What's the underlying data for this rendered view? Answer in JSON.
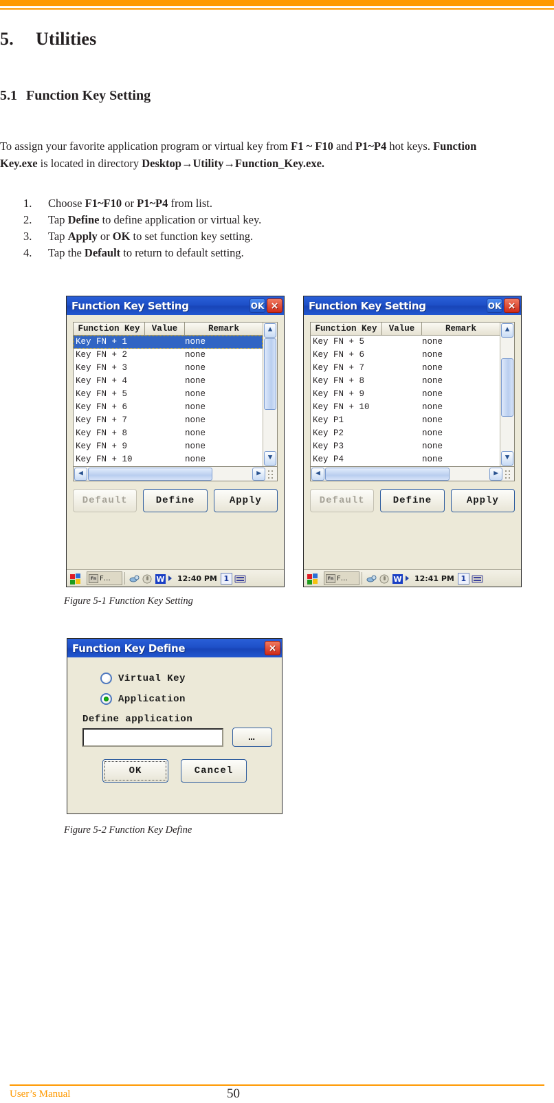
{
  "document": {
    "chapter_number": "5.",
    "chapter_title": "Utilities",
    "section_number": "5.1",
    "section_title": "Function Key Setting",
    "intro": {
      "p1": "To assign your favorite application program or virtual key from ",
      "b1": "F1 ~ F10",
      "p2": " and  ",
      "b2": "P1~P4",
      "p3": " hot keys. ",
      "b3": "Function Key.exe",
      "p4": " is located in directory ",
      "b4": "Desktop→Utility→Function_Key.exe."
    },
    "steps": [
      {
        "marker": "1.",
        "pre": "Choose ",
        "b1": "F1~F10",
        "mid": " or ",
        "b2": "P1~P4",
        "post": " from list."
      },
      {
        "marker": "2.",
        "pre": "Tap ",
        "b1": "Define",
        "mid": "",
        "b2": "",
        "post": " to define application or virtual key."
      },
      {
        "marker": "3.",
        "pre": "Tap ",
        "b1": "Apply",
        "mid": " or ",
        "b2": "OK",
        "post": " to set function key setting."
      },
      {
        "marker": "4.",
        "pre": "Tap the ",
        "b1": "Default",
        "mid": "",
        "b2": "",
        "post": " to return to default setting."
      }
    ],
    "captions": {
      "fig_5_1": "Figure 5-1 Function Key Setting",
      "fig_5_2": "Figure 5-2 Function Key Define"
    },
    "footer": {
      "left": "User’s Manual",
      "page": "50"
    },
    "colors": {
      "accent": "#ff9900",
      "titlebar": "#1e50c8",
      "selection": "#3165c4",
      "radio_on": "#12b312"
    }
  },
  "fig1_left": {
    "title": "Function Key Setting",
    "ok_label": "OK",
    "close_label": "×",
    "columns": [
      "Function Key",
      "Value",
      "Remark"
    ],
    "rows": [
      {
        "key": "Key FN + 1",
        "value": "",
        "remark": "none",
        "selected": true
      },
      {
        "key": "Key FN + 2",
        "value": "",
        "remark": "none",
        "selected": false
      },
      {
        "key": "Key FN + 3",
        "value": "",
        "remark": "none",
        "selected": false
      },
      {
        "key": "Key FN + 4",
        "value": "",
        "remark": "none",
        "selected": false
      },
      {
        "key": "Key FN + 5",
        "value": "",
        "remark": "none",
        "selected": false
      },
      {
        "key": "Key FN + 6",
        "value": "",
        "remark": "none",
        "selected": false
      },
      {
        "key": "Key FN + 7",
        "value": "",
        "remark": "none",
        "selected": false
      },
      {
        "key": "Key FN + 8",
        "value": "",
        "remark": "none",
        "selected": false
      },
      {
        "key": "Key FN + 9",
        "value": "",
        "remark": "none",
        "selected": false
      },
      {
        "key": "Key FN + 10",
        "value": "",
        "remark": "none",
        "selected": false
      }
    ],
    "buttons": {
      "default": "Default",
      "define": "Define",
      "apply": "Apply"
    },
    "default_disabled": true,
    "taskbar": {
      "task_label": "F…",
      "fn_label": "Fn",
      "time": "12:40 PM",
      "indicator": "1"
    }
  },
  "fig1_right": {
    "title": "Function Key Setting",
    "ok_label": "OK",
    "close_label": "×",
    "columns": [
      "Function Key",
      "Value",
      "Remark"
    ],
    "rows": [
      {
        "key": "Key FN + 5",
        "value": "",
        "remark": "none",
        "selected": false
      },
      {
        "key": "Key FN + 6",
        "value": "",
        "remark": "none",
        "selected": false
      },
      {
        "key": "Key FN + 7",
        "value": "",
        "remark": "none",
        "selected": false
      },
      {
        "key": "Key FN + 8",
        "value": "",
        "remark": "none",
        "selected": false
      },
      {
        "key": "Key FN + 9",
        "value": "",
        "remark": "none",
        "selected": false
      },
      {
        "key": "Key FN + 10",
        "value": "",
        "remark": "none",
        "selected": false
      },
      {
        "key": "Key P1",
        "value": "",
        "remark": "none",
        "selected": false
      },
      {
        "key": "Key P2",
        "value": "",
        "remark": "none",
        "selected": false
      },
      {
        "key": "Key P3",
        "value": "",
        "remark": "none",
        "selected": false
      },
      {
        "key": "Key P4",
        "value": "",
        "remark": "none",
        "selected": false
      }
    ],
    "buttons": {
      "default": "Default",
      "define": "Define",
      "apply": "Apply"
    },
    "default_disabled": true,
    "taskbar": {
      "task_label": "F…",
      "fn_label": "Fn",
      "time": "12:41 PM",
      "indicator": "1"
    }
  },
  "fig2": {
    "title": "Function Key Define",
    "close_label": "×",
    "options": [
      {
        "label": "Virtual Key",
        "selected": false
      },
      {
        "label": "Application",
        "selected": true
      }
    ],
    "field_label": "Define application",
    "field_value": "",
    "browse_label": "…",
    "ok_label": "OK",
    "cancel_label": "Cancel"
  }
}
